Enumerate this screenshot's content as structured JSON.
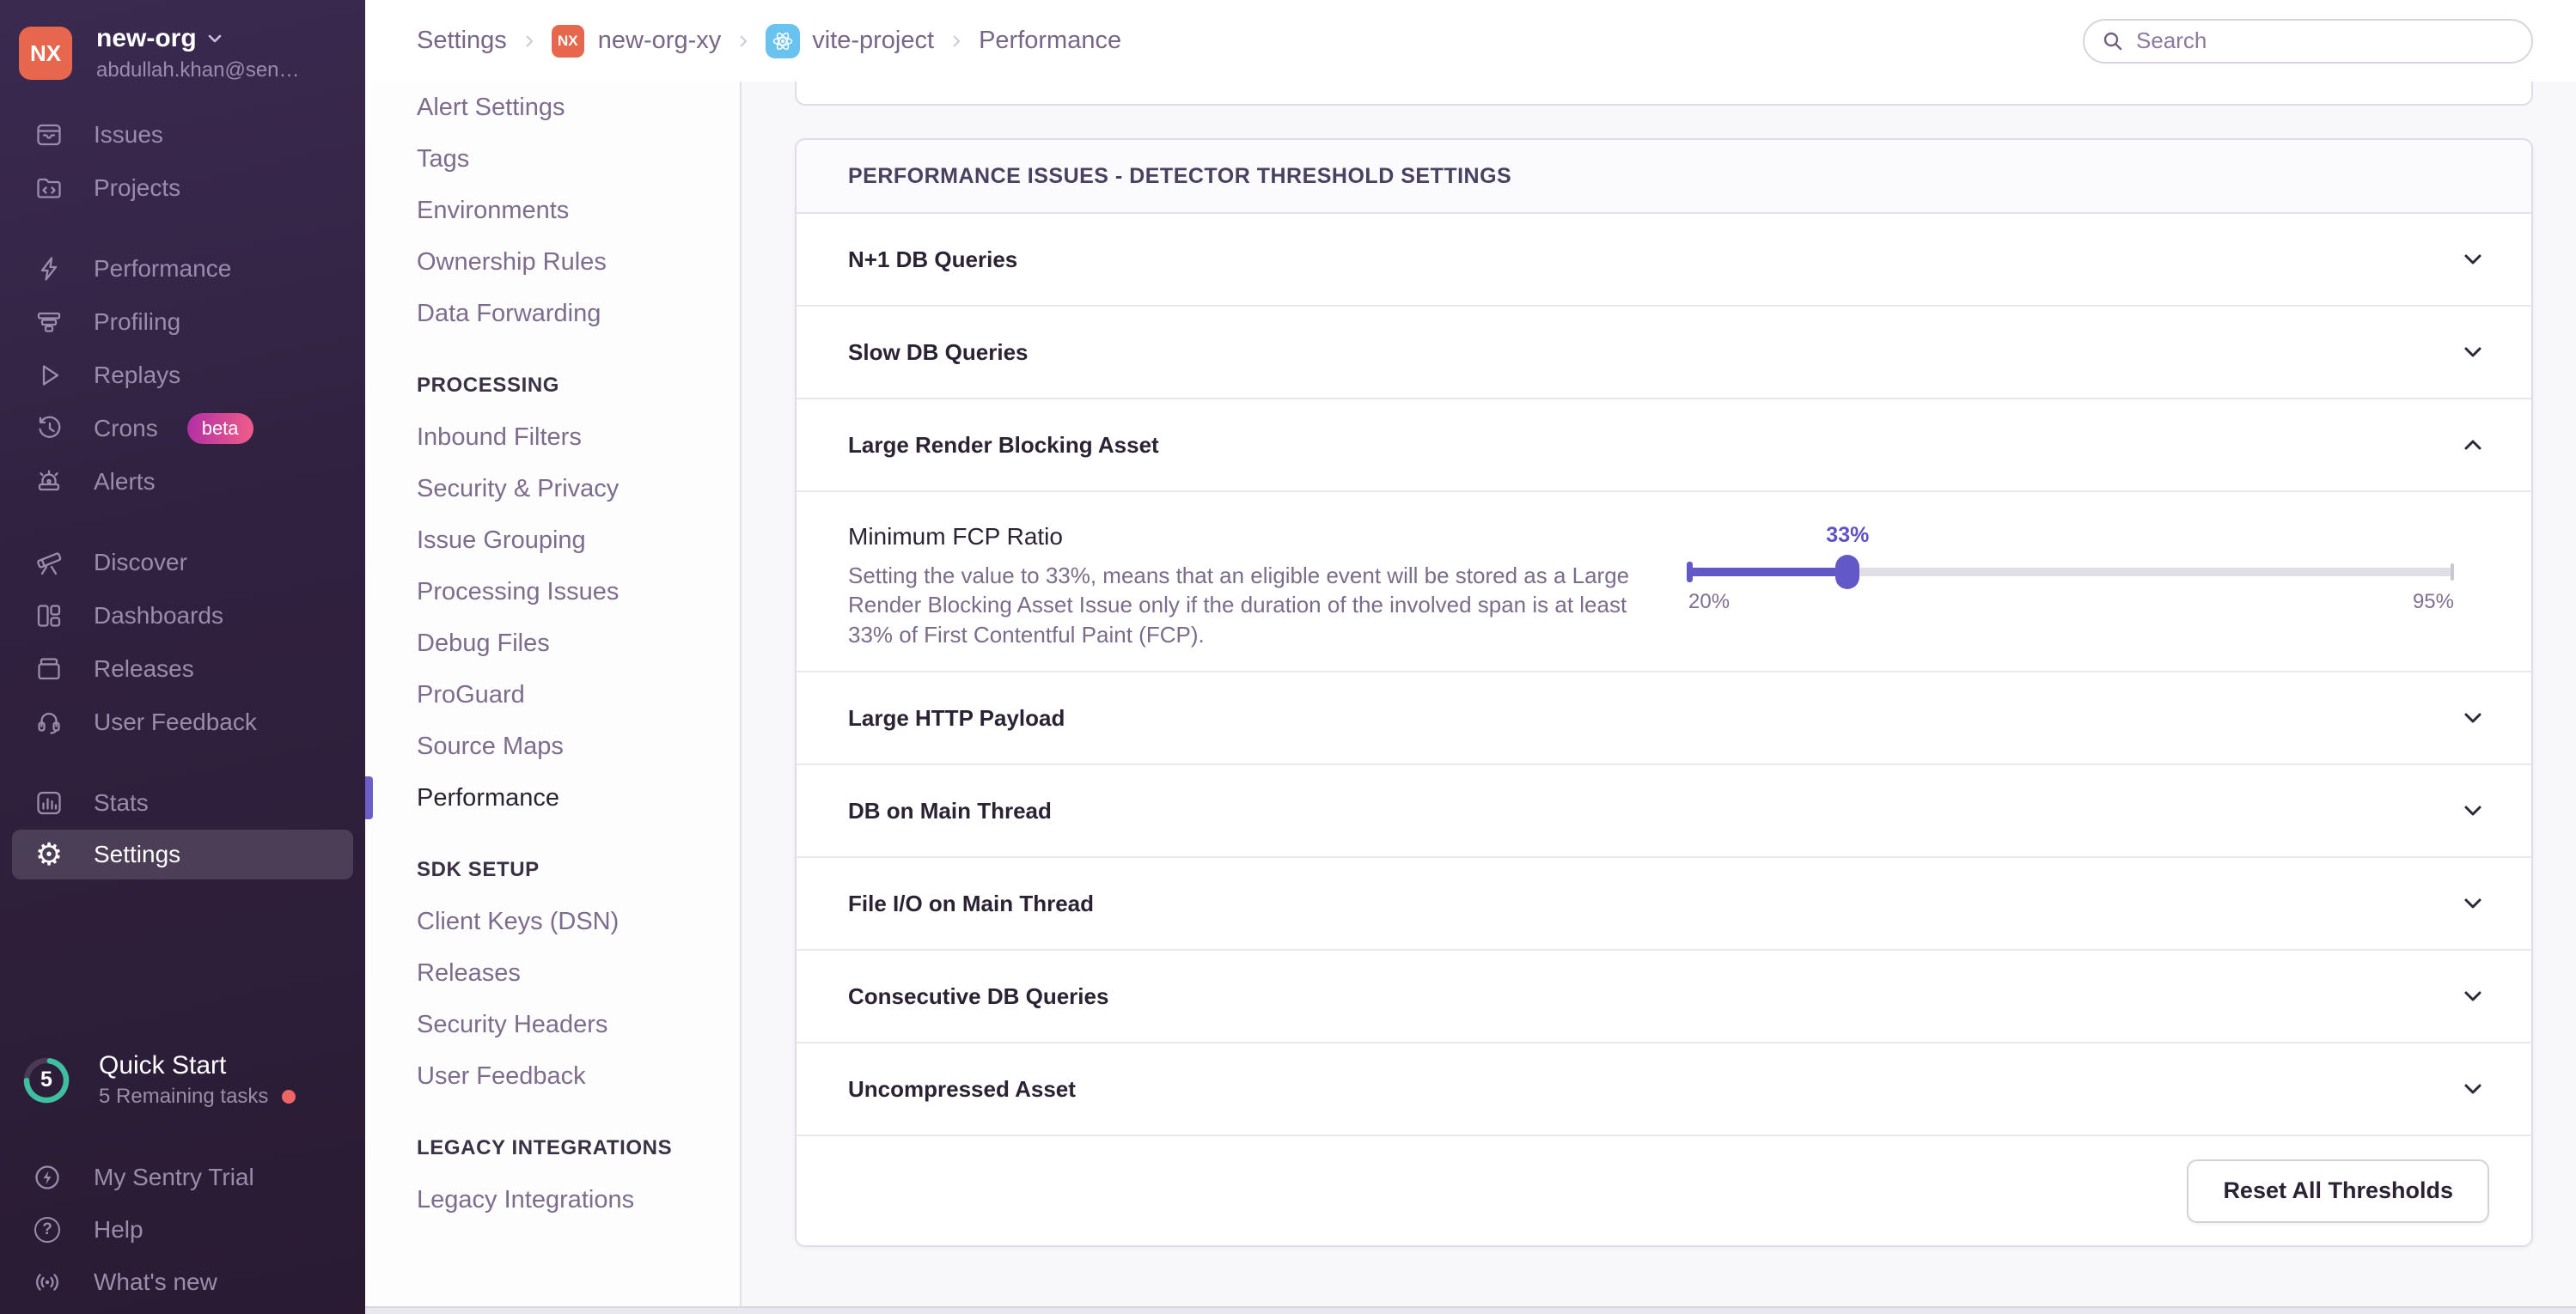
{
  "sidebar": {
    "org_initials": "NX",
    "org_name": "new-org",
    "org_email": "abdullah.khan@sen…",
    "items": [
      {
        "label": "Issues"
      },
      {
        "label": "Projects"
      },
      {
        "label": "Performance"
      },
      {
        "label": "Profiling"
      },
      {
        "label": "Replays"
      },
      {
        "label": "Crons",
        "badge": "beta"
      },
      {
        "label": "Alerts"
      },
      {
        "label": "Discover"
      },
      {
        "label": "Dashboards"
      },
      {
        "label": "Releases"
      },
      {
        "label": "User Feedback"
      },
      {
        "label": "Stats"
      },
      {
        "label": "Settings"
      }
    ],
    "quick_start": {
      "count": "5",
      "title": "Quick Start",
      "subtitle": "5 Remaining tasks"
    },
    "footer_items": [
      {
        "label": "My Sentry Trial"
      },
      {
        "label": "Help"
      },
      {
        "label": "What's new"
      }
    ]
  },
  "breadcrumb": {
    "items": [
      {
        "label": "Settings"
      },
      {
        "label": "new-org-xy",
        "badge": "NX"
      },
      {
        "label": "vite-project",
        "icon": "react-icon"
      },
      {
        "label": "Performance"
      }
    ]
  },
  "search": {
    "placeholder": "Search"
  },
  "settings_nav": {
    "groups": [
      {
        "header": "",
        "items": [
          "Alert Settings",
          "Tags",
          "Environments",
          "Ownership Rules",
          "Data Forwarding"
        ]
      },
      {
        "header": "PROCESSING",
        "items": [
          "Inbound Filters",
          "Security & Privacy",
          "Issue Grouping",
          "Processing Issues",
          "Debug Files",
          "ProGuard",
          "Source Maps",
          "Performance"
        ]
      },
      {
        "header": "SDK SETUP",
        "items": [
          "Client Keys (DSN)",
          "Releases",
          "Security Headers",
          "User Feedback"
        ]
      },
      {
        "header": "LEGACY INTEGRATIONS",
        "items": [
          "Legacy Integrations"
        ]
      }
    ],
    "active_item": "Performance"
  },
  "panel": {
    "header": "PERFORMANCE ISSUES - DETECTOR THRESHOLD SETTINGS",
    "rows": [
      {
        "label": "N+1 DB Queries",
        "state": "collapsed"
      },
      {
        "label": "Slow DB Queries",
        "state": "collapsed"
      },
      {
        "label": "Large Render Blocking Asset",
        "state": "expanded"
      },
      {
        "label": "Large HTTP Payload",
        "state": "collapsed"
      },
      {
        "label": "DB on Main Thread",
        "state": "collapsed"
      },
      {
        "label": "File I/O on Main Thread",
        "state": "collapsed"
      },
      {
        "label": "Consecutive DB Queries",
        "state": "collapsed"
      },
      {
        "label": "Uncompressed Asset",
        "state": "collapsed"
      }
    ],
    "expanded_detail": {
      "title": "Minimum FCP Ratio",
      "description": "Setting the value to 33%, means that an eligible event will be stored as a Large Render Blocking Asset Issue only if the duration of the involved span is at least 33% of First Contentful Paint (FCP).",
      "slider": {
        "value_label": "33%",
        "min_label": "20%",
        "max_label": "95%",
        "position_percent": 20.8
      }
    },
    "footer_button": "Reset All Thresholds"
  },
  "colors": {
    "accent_purple": "#6c5fc7",
    "slider_purple": "#6358c8",
    "org_avatar_orange": "#e7674e",
    "beta_gradient": [
      "#b02fa6",
      "#f25d87"
    ],
    "react_badge_blue": "#6ac3ef",
    "progress_ring_green": "#3ebfa0",
    "notification_dot_red": "#ef6465",
    "sidebar_bg": "#2f2040"
  }
}
